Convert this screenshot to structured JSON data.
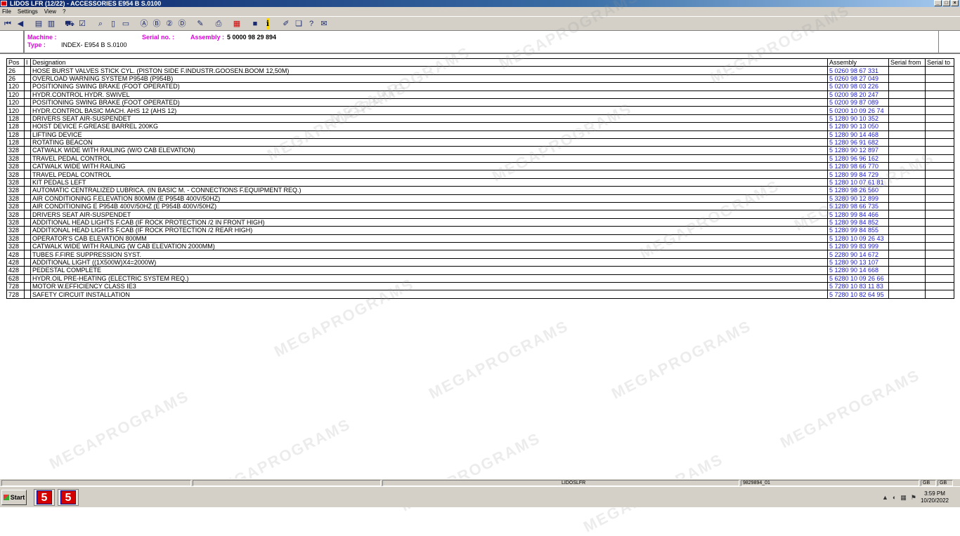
{
  "window": {
    "title": "LIDOS LFR (12/22) - ACCESSORIES E954 B S.0100",
    "controls": [
      "_",
      "□",
      "×"
    ]
  },
  "menu": [
    "File",
    "Settings",
    "View",
    "?"
  ],
  "toolbar": {
    "icons": [
      "first-icon",
      "prev-icon",
      "sep",
      "doc-back-icon",
      "doc-forward-icon",
      "sep",
      "cart-icon",
      "checklist-icon",
      "sep",
      "zoom-icon",
      "page-icon",
      "pages-icon",
      "sep",
      "search-a-icon",
      "search-b-icon",
      "search-c-icon",
      "search-d-icon",
      "sep",
      "edit-icon",
      "sep",
      "print-icon",
      "sep",
      "grid-icon",
      "sep",
      "blue-square-icon",
      "info-icon",
      "sep",
      "tool-icon",
      "book-icon",
      "help-icon",
      "mail-icon"
    ]
  },
  "header": {
    "machine_label": "Machine :",
    "machine_value": "",
    "serial_label": "Serial no. :",
    "serial_value": "",
    "assembly_label": "Assembly :",
    "assembly_value": "5 0000 98 29 894",
    "type_label": "Type :",
    "type_value": "INDEX- E954 B  S.0100"
  },
  "table": {
    "columns": [
      "Pos",
      "I",
      "Designation",
      "Assembly",
      "Serial from",
      "Serial to"
    ],
    "rows": [
      [
        "26",
        "",
        "HOSE BURST VALVES STICK CYL. (PISTON SIDE F.INDUSTR.GOOSEN.BOOM 12,50M)",
        "5 0260 98 67 331",
        "",
        ""
      ],
      [
        "26",
        "",
        "OVERLOAD WARNING SYSTEM P954B (P954B)",
        "5 0260 98 27 049",
        "",
        ""
      ],
      [
        "120",
        "",
        "POSITIONING SWING BRAKE (FOOT OPERATED)",
        "5 0200 98 03 226",
        "",
        ""
      ],
      [
        "120",
        "",
        "HYDR.CONTROL HYDR. SWIVEL",
        "5 0200 98 20 247",
        "",
        ""
      ],
      [
        "120",
        "",
        "POSITIONING SWING BRAKE (FOOT OPERATED)",
        "5 0200 99 87 089",
        "",
        ""
      ],
      [
        "120",
        "",
        "HYDR.CONTROL BASIC MACH. AHS 12 (AHS 12)",
        "5 0200 10 09 26 74",
        "",
        ""
      ],
      [
        "128",
        "",
        "DRIVERS SEAT AIR-SUSPENDET",
        "5 1280 90 10 352",
        "",
        ""
      ],
      [
        "128",
        "",
        "HOIST DEVICE F.GREASE BARREL 200KG",
        "5 1280 90 13 050",
        "",
        ""
      ],
      [
        "128",
        "",
        "LIFTING DEVICE",
        "5 1280 90 14 468",
        "",
        ""
      ],
      [
        "128",
        "",
        "ROTATING BEACON",
        "5 1280 96 91 682",
        "",
        ""
      ],
      [
        "328",
        "",
        "CATWALK WIDE WITH RAILING (W/O CAB ELEVATION)",
        "5 1280 90 12 897",
        "",
        ""
      ],
      [
        "328",
        "",
        "TRAVEL PEDAL CONTROL",
        "5 1280 96 96 162",
        "",
        ""
      ],
      [
        "328",
        "",
        "CATWALK WIDE WITH RAILING",
        "5 1280 98 66 770",
        "",
        ""
      ],
      [
        "328",
        "",
        "TRAVEL PEDAL CONTROL",
        "5 1280 99 84 729",
        "",
        ""
      ],
      [
        "328",
        "",
        "KIT PEDALS LEFT",
        "5 1280 10 07 61 81",
        "",
        ""
      ],
      [
        "328",
        "",
        "AUTOMATIC CENTRALIZED LUBRICA. (IN BASIC M. - CONNECTIONS F.EQUIPMENT REQ.)",
        "5 1280 98 26 560",
        "",
        ""
      ],
      [
        "328",
        "",
        "AIR CONDITIONING F.ELEVATION 800MM (E P954B 400V/50HZ)",
        "5 3280 90 12 899",
        "",
        ""
      ],
      [
        "328",
        "",
        "AIR CONDITIONING E P954B 400V/50HZ (E P954B 400V/50HZ)",
        "5 1280 98 66 735",
        "",
        ""
      ],
      [
        "328",
        "",
        "DRIVERS SEAT AIR-SUSPENDET",
        "5 1280 99 84 466",
        "",
        ""
      ],
      [
        "328",
        "",
        "ADDITIONAL HEAD LIGHTS F.CAB (IF ROCK PROTECTION /2 IN FRONT HIGH)",
        "5 1280 99 84 852",
        "",
        ""
      ],
      [
        "328",
        "",
        "ADDITIONAL HEAD LIGHTS F.CAB (IF ROCK PROTECTION /2 REAR HIGH)",
        "5 1280 99 84 855",
        "",
        ""
      ],
      [
        "328",
        "",
        "OPERATOR'S CAB ELEVATION 800MM",
        "5 1280 10 09 26 43",
        "",
        ""
      ],
      [
        "328",
        "",
        "CATWALK WIDE WITH RAILING (W CAB ELEVATION 2000MM)",
        "5 1280 99 83 999",
        "",
        ""
      ],
      [
        "428",
        "",
        "TUBES F.FIRE SUPPRESSION SYST.",
        "5 2280 90 14 672",
        "",
        ""
      ],
      [
        "428",
        "",
        "ADDITIONAL LIGHT ((1X500W)X4=2000W)",
        "5 1280 90 13 107",
        "",
        ""
      ],
      [
        "428",
        "",
        "PEDESTAL COMPLETE",
        "5 1280 90 14 668",
        "",
        ""
      ],
      [
        "628",
        "",
        "HYDR.OIL PRE-HEATING (ELECTRIC SYSTEM REQ.)",
        "5 6280 10 09 26 66",
        "",
        ""
      ],
      [
        "728",
        "",
        "MOTOR W.EFFICIENCY CLASS IE3",
        "5 7280 10 83 11 83",
        "",
        ""
      ],
      [
        "728",
        "",
        "SAFETY CIRCUIT INSTALLATION",
        "5 7280 10 82 64 95",
        "",
        ""
      ]
    ]
  },
  "statusbar": {
    "seg3": "LIDOSLFR",
    "seg4": "9829894_01",
    "seg5": "GB",
    "seg6": "GB"
  },
  "taskbar": {
    "start": "Start",
    "apps": [
      "5",
      "5"
    ],
    "time": "3:59 PM",
    "date": "10/20/2022"
  },
  "watermark_text": "MEGAPROGRAMS"
}
